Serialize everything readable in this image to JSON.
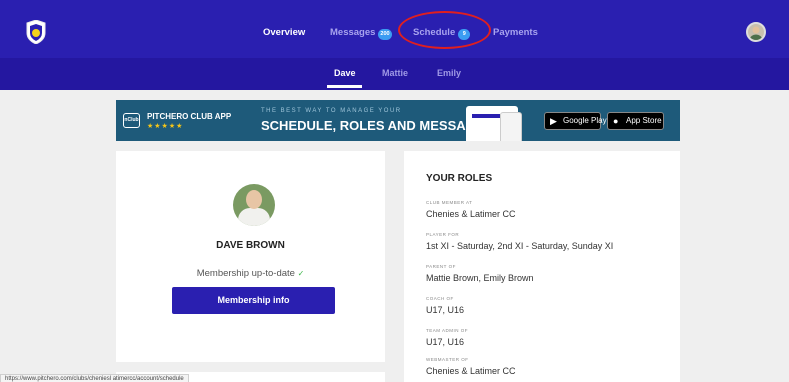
{
  "nav": {
    "items": [
      {
        "label": "Overview"
      },
      {
        "label": "Messages",
        "badge": "200"
      },
      {
        "label": "Schedule",
        "badge": "9"
      },
      {
        "label": "Payments"
      }
    ]
  },
  "subnav": {
    "items": [
      {
        "label": "Dave"
      },
      {
        "label": "Mattie"
      },
      {
        "label": "Emily"
      }
    ]
  },
  "banner": {
    "club_badge": "nClub",
    "app_name": "PITCHERO CLUB APP",
    "stars": "★★★★★",
    "tagline": "THE BEST WAY TO MANAGE YOUR",
    "headline": "SCHEDULE, ROLES AND MESSAGES",
    "google_play": "Google Play",
    "app_store": "App Store"
  },
  "profile": {
    "name": "DAVE BROWN",
    "membership_status": "Membership up-to-date",
    "check": "✓",
    "membership_button": "Membership info"
  },
  "roles": {
    "title": "YOUR ROLES",
    "items": [
      {
        "label": "CLUB MEMBER AT",
        "value": "Chenies & Latimer CC"
      },
      {
        "label": "PLAYER FOR",
        "value": "1st XI - Saturday, 2nd XI - Saturday, Sunday XI"
      },
      {
        "label": "PARENT OF",
        "value": "Mattie Brown, Emily Brown"
      },
      {
        "label": "COACH OF",
        "value": "U17, U16"
      },
      {
        "label": "TEAM ADMIN OF",
        "value": "U17, U16"
      },
      {
        "label": "WEBMASTER OF",
        "value": "Chenies & Latimer CC"
      }
    ]
  },
  "status_url": "https://www.pitchero.com/clubs/cheniesl atimercc/account/schedule",
  "colors": {
    "nav_bg": "#2a1fb0",
    "subnav_bg": "#2417a0",
    "banner_bg": "#1e5a7a",
    "annotation": "#e01f1f"
  }
}
